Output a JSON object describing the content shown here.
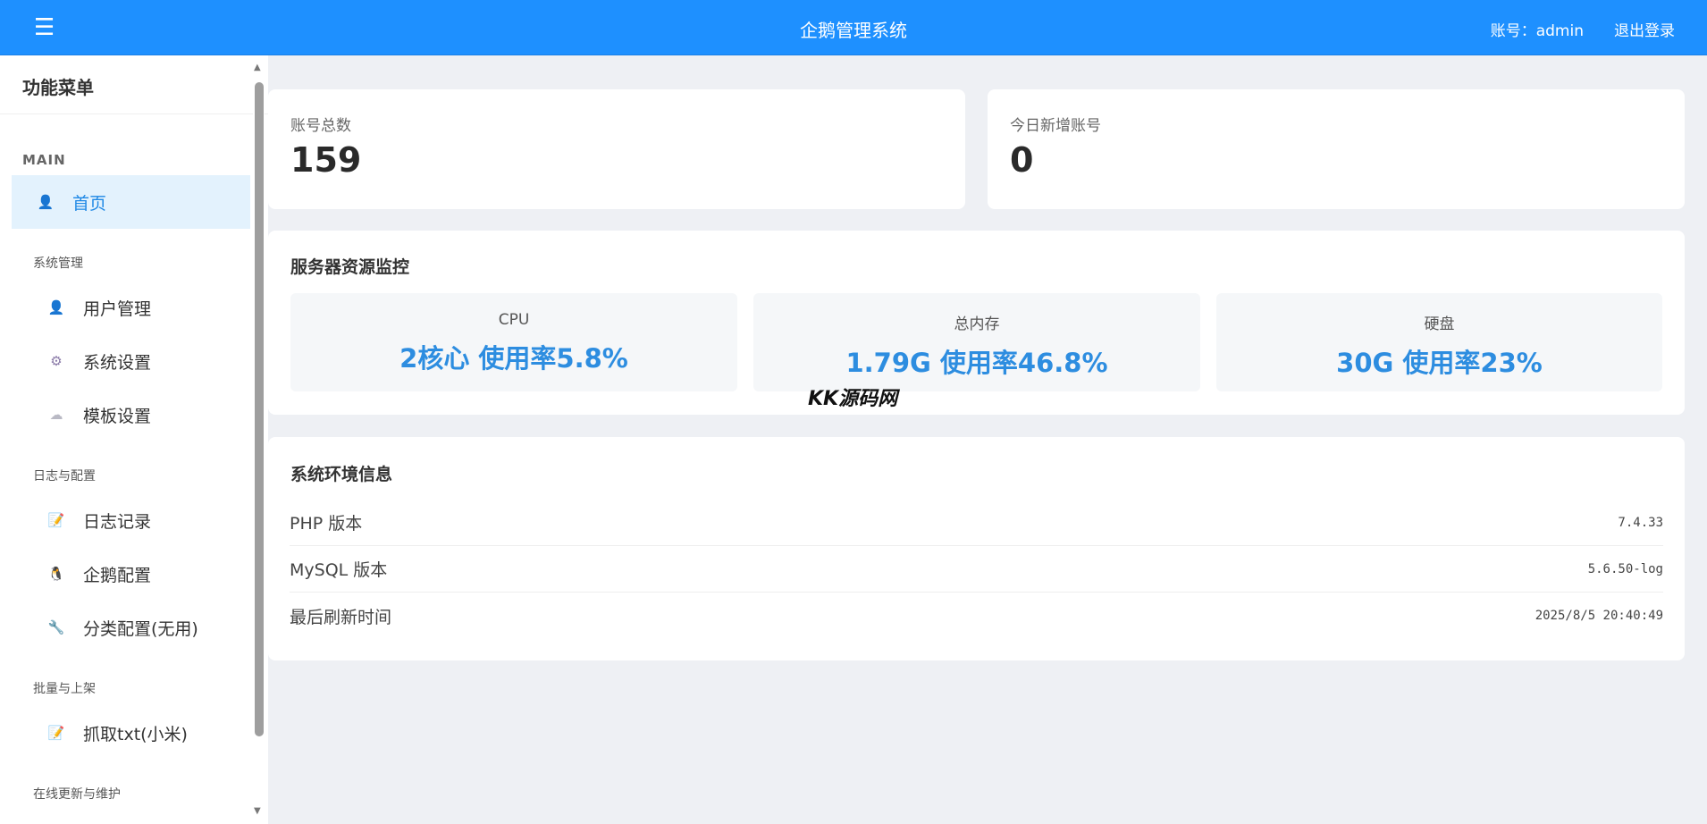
{
  "header": {
    "menu_icon": "☰",
    "title": "企鹅管理系统",
    "account": "账号：admin",
    "logout": "退出登录"
  },
  "sidebar": {
    "title": "功能菜单",
    "section": "MAIN",
    "home": {
      "label": "首页",
      "icon": "user-icon"
    },
    "groups": [
      {
        "label": "系统管理",
        "items": [
          {
            "label": "用户管理",
            "icon": "user-icon"
          },
          {
            "label": "系统设置",
            "icon": "gear-icon"
          },
          {
            "label": "模板设置",
            "icon": "template-icon"
          }
        ]
      },
      {
        "label": "日志与配置",
        "items": [
          {
            "label": "日志记录",
            "icon": "document-icon"
          },
          {
            "label": "企鹅配置",
            "icon": "penguin-icon"
          },
          {
            "label": "分类配置(无用)",
            "icon": "tools-icon"
          }
        ]
      },
      {
        "label": "批量与上架",
        "items": [
          {
            "label": "抓取txt(小米)",
            "icon": "document-icon"
          }
        ]
      },
      {
        "label": "在线更新与维护",
        "items": []
      }
    ]
  },
  "stats": {
    "total_accounts_label": "账号总数",
    "total_accounts_value": "159",
    "new_today_label": "今日新增账号",
    "new_today_value": "0"
  },
  "monitor": {
    "title": "服务器资源监控",
    "cpu_label": "CPU",
    "cpu_value": "2核心 使用率5.8%",
    "mem_label": "总内存",
    "mem_value": "1.79G 使用率46.8%",
    "disk_label": "硬盘",
    "disk_value": "30G 使用率23%"
  },
  "env": {
    "title": "系统环境信息",
    "rows": [
      {
        "label": "PHP 版本",
        "value": "7.4.33"
      },
      {
        "label": "MySQL 版本",
        "value": "5.6.50-log"
      },
      {
        "label": "最后刷新时间",
        "value": "2025/8/5 20:40:49"
      }
    ]
  },
  "watermark": "KK源码网",
  "colors": {
    "accent": "#1e90ff",
    "value_blue": "#2d8de0",
    "active_bg": "#e3f2fd"
  }
}
